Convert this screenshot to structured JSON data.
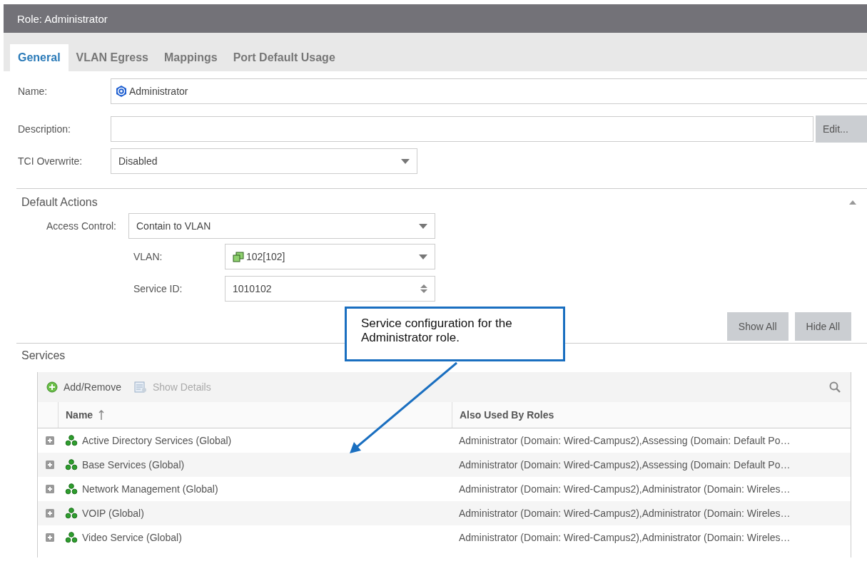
{
  "window": {
    "title": "Role: Administrator"
  },
  "tabs": [
    {
      "label": "General",
      "selected": true
    },
    {
      "label": "VLAN Egress",
      "selected": false
    },
    {
      "label": "Mappings",
      "selected": false
    },
    {
      "label": "Port Default Usage",
      "selected": false
    }
  ],
  "form": {
    "name": {
      "label": "Name:",
      "value": "Administrator"
    },
    "description": {
      "label": "Description:",
      "button": "Edit..."
    },
    "tci_overwrite": {
      "label": "TCI Overwrite:",
      "value": "Disabled"
    }
  },
  "default_actions": {
    "title": "Default Actions",
    "expanded": true,
    "access_control": {
      "label": "Access Control:",
      "value": "Contain to VLAN"
    },
    "vlan": {
      "label": "VLAN:",
      "value": "102[102]"
    },
    "service_id": {
      "label": "Service ID:",
      "value": "1010102"
    },
    "buttons": [
      "Show All",
      "Hide All"
    ]
  },
  "services": {
    "title": "Services",
    "toolbar": [
      {
        "label": "Add/Remove",
        "disabled": false
      },
      {
        "label": "Show Details",
        "disabled": true
      }
    ],
    "columns": [
      {
        "label": "Name",
        "sorted": true
      },
      {
        "label": "Also Used By Roles",
        "sorted": false
      }
    ],
    "rows": [
      {
        "name": "Active Directory Services (Global)",
        "also_used_by_roles": "Administrator (Domain: Wired-Campus2),Assessing (Domain: Default Po…",
        "expanded": false
      },
      {
        "name": "Base Services (Global)",
        "also_used_by_roles": "Administrator (Domain: Wired-Campus2),Assessing (Domain: Default Po…",
        "expanded": false
      },
      {
        "name": "Network Management (Global)",
        "also_used_by_roles": "Administrator (Domain: Wired-Campus2),Administrator (Domain: Wireles…",
        "expanded": false
      },
      {
        "name": "VOIP (Global)",
        "also_used_by_roles": "Administrator (Domain: Wired-Campus2),Administrator (Domain: Wireles…",
        "expanded": false
      },
      {
        "name": "Video Service (Global)",
        "also_used_by_roles": "Administrator (Domain: Wired-Campus2),Administrator (Domain: Wireles…",
        "expanded": false
      }
    ]
  },
  "callout": {
    "text": "Service configuration for the Administrator role."
  }
}
